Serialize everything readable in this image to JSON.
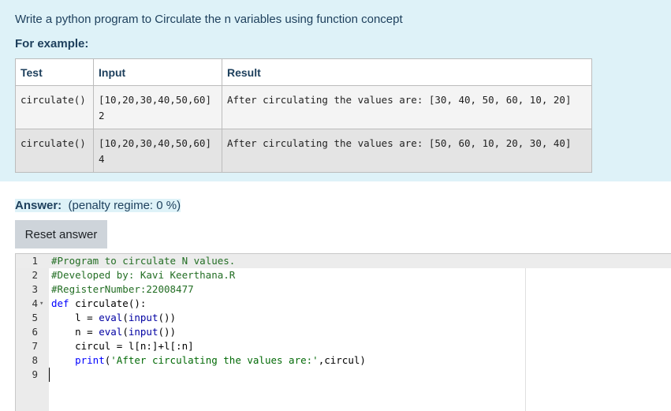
{
  "question": {
    "prompt": "Write a python program to Circulate the n variables using function concept",
    "for_example": "For example:",
    "table": {
      "headers": [
        "Test",
        "Input",
        "Result"
      ],
      "rows": [
        {
          "test": "circulate()",
          "input_line1": "[10,20,30,40,50,60]",
          "input_line2": "2",
          "result": "After circulating the values are: [30, 40, 50, 60, 10, 20]"
        },
        {
          "test": "circulate()",
          "input_line1": "[10,20,30,40,50,60]",
          "input_line2": "4",
          "result": "After circulating the values are: [50, 60, 10, 20, 30, 40]"
        }
      ]
    }
  },
  "answer": {
    "label": "Answer:",
    "penalty": "(penalty regime: 0 %)",
    "reset_label": "Reset answer"
  },
  "editor": {
    "fold_icon": "▾",
    "lines": [
      {
        "num": "1",
        "text": "#Program to circulate N values."
      },
      {
        "num": "2",
        "text": "#Developed by: Kavi Keerthana.R"
      },
      {
        "num": "3",
        "text": "#RegisterNumber:22008477"
      },
      {
        "num": "4",
        "text": "def circulate():"
      },
      {
        "num": "5",
        "text": "    l = eval(input())"
      },
      {
        "num": "6",
        "text": "    n = eval(input())"
      },
      {
        "num": "7",
        "text": "    circul = l[n:]+l[:n]"
      },
      {
        "num": "8",
        "text": "    print('After circulating the values are:',circul)"
      },
      {
        "num": "9",
        "text": ""
      }
    ]
  }
}
